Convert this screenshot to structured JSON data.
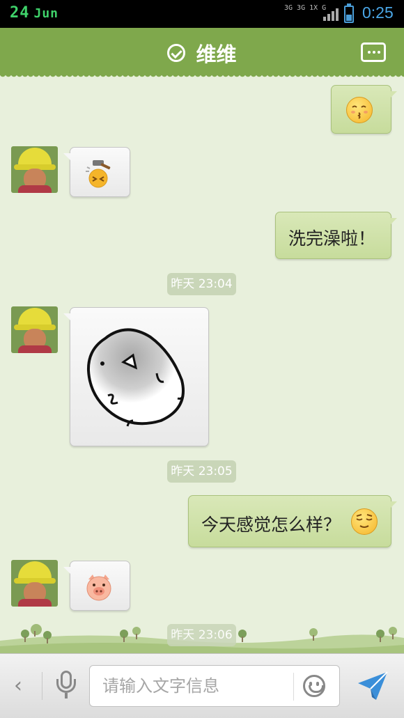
{
  "status_bar": {
    "day": "24",
    "month": "Jun",
    "network_top": "3G 3G 1X G",
    "time": "0:25"
  },
  "header": {
    "title": "维维",
    "status_icon": "check-circle-icon",
    "more_icon": "more-dots-icon"
  },
  "messages": [
    {
      "side": "right",
      "type": "emoji",
      "icon": "kiss-emoji-icon"
    },
    {
      "side": "left",
      "type": "emoji",
      "icon": "hammer-hit-emoji-icon"
    },
    {
      "side": "right",
      "type": "text",
      "text": "洗完澡啦！"
    },
    {
      "type": "timestamp",
      "text": "昨天 23:04"
    },
    {
      "side": "left",
      "type": "sticker",
      "icon": "ghost-blob-sticker-icon"
    },
    {
      "type": "timestamp",
      "text": "昨天 23:05"
    },
    {
      "side": "right",
      "type": "text",
      "text": "今天感觉怎么样？",
      "icon": "content-smile-emoji-icon"
    },
    {
      "side": "left",
      "type": "emoji",
      "icon": "pig-emoji-icon"
    },
    {
      "type": "timestamp",
      "text": "昨天 23:06"
    }
  ],
  "input_bar": {
    "back_glyph": "‹",
    "placeholder": "请输入文字信息",
    "value": ""
  },
  "colors": {
    "header_green": "#7fa84c",
    "chat_bg": "#e8f0dc",
    "bubble_right": "#cfe1a9",
    "bubble_left": "#f2f2f2",
    "time_blue": "#4aa6e6",
    "send_blue": "#3b8fd9"
  }
}
